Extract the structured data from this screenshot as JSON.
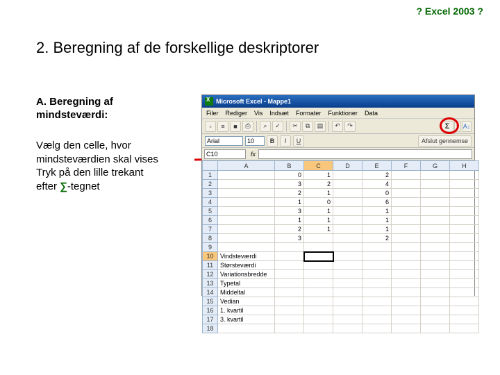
{
  "header": {
    "label": "? Excel 2003 ?"
  },
  "heading": "2. Beregning af de forskellige deskriptorer",
  "subheading_line1": "A. Beregning af",
  "subheading_line2": "mindsteværdi:",
  "instruction_line1": "Vælg den celle, hvor",
  "instruction_line2": "mindsteværdien skal vises",
  "instruction_line3": "Tryk på den lille trekant",
  "instruction_line4_a": "efter ",
  "instruction_line4_sigma": "∑",
  "instruction_line4_b": "-tegnet",
  "excel": {
    "title": "Microsoft Excel - Mappe1",
    "menu": [
      "Filer",
      "Rediger",
      "Vis",
      "Indsæt",
      "Formater",
      "Funktioner",
      "Data"
    ],
    "namebox": "C10",
    "fx": "fx",
    "sigma": "Σ",
    "tri": "▾",
    "font_name": "Arial",
    "font_size": "10",
    "sort_az": "A↓",
    "run_label": "Afslut gennemse",
    "columns": [
      "",
      "A",
      "B",
      "C",
      "D",
      "E",
      "F",
      "G",
      "H"
    ],
    "rows": [
      {
        "n": "1",
        "a": "",
        "b": "0",
        "c": "1",
        "d": "",
        "e": "2",
        "f": "",
        "g": "",
        "h": ""
      },
      {
        "n": "2",
        "a": "",
        "b": "3",
        "c": "2",
        "d": "",
        "e": "4",
        "f": "",
        "g": "",
        "h": ""
      },
      {
        "n": "3",
        "a": "",
        "b": "2",
        "c": "1",
        "d": "",
        "e": "0",
        "f": "",
        "g": "",
        "h": ""
      },
      {
        "n": "4",
        "a": "",
        "b": "1",
        "c": "0",
        "d": "",
        "e": "6",
        "f": "",
        "g": "",
        "h": ""
      },
      {
        "n": "5",
        "a": "",
        "b": "3",
        "c": "1",
        "d": "",
        "e": "1",
        "f": "",
        "g": "",
        "h": ""
      },
      {
        "n": "6",
        "a": "",
        "b": "1",
        "c": "1",
        "d": "",
        "e": "1",
        "f": "",
        "g": "",
        "h": ""
      },
      {
        "n": "7",
        "a": "",
        "b": "2",
        "c": "1",
        "d": "",
        "e": "1",
        "f": "",
        "g": "",
        "h": ""
      },
      {
        "n": "8",
        "a": "",
        "b": "3",
        "c": "",
        "d": "",
        "e": "2",
        "f": "",
        "g": "",
        "h": ""
      },
      {
        "n": "9",
        "a": "",
        "b": "",
        "c": "",
        "d": "",
        "e": "",
        "f": "",
        "g": "",
        "h": ""
      },
      {
        "n": "10",
        "a": "Vindsteværdi",
        "b": "",
        "c": "",
        "d": "",
        "e": "",
        "f": "",
        "g": "",
        "h": ""
      },
      {
        "n": "11",
        "a": "Størsteværdi",
        "b": "",
        "c": "",
        "d": "",
        "e": "",
        "f": "",
        "g": "",
        "h": ""
      },
      {
        "n": "12",
        "a": "Variationsbredde",
        "b": "",
        "c": "",
        "d": "",
        "e": "",
        "f": "",
        "g": "",
        "h": ""
      },
      {
        "n": "13",
        "a": "Typetal",
        "b": "",
        "c": "",
        "d": "",
        "e": "",
        "f": "",
        "g": "",
        "h": ""
      },
      {
        "n": "14",
        "a": "Middeltal",
        "b": "",
        "c": "",
        "d": "",
        "e": "",
        "f": "",
        "g": "",
        "h": ""
      },
      {
        "n": "15",
        "a": "Vedian",
        "b": "",
        "c": "",
        "d": "",
        "e": "",
        "f": "",
        "g": "",
        "h": ""
      },
      {
        "n": "16",
        "a": "1. kvartil",
        "b": "",
        "c": "",
        "d": "",
        "e": "",
        "f": "",
        "g": "",
        "h": ""
      },
      {
        "n": "17",
        "a": "3. kvartil",
        "b": "",
        "c": "",
        "d": "",
        "e": "",
        "f": "",
        "g": "",
        "h": ""
      },
      {
        "n": "18",
        "a": "",
        "b": "",
        "c": "",
        "d": "",
        "e": "",
        "f": "",
        "g": "",
        "h": ""
      }
    ]
  }
}
